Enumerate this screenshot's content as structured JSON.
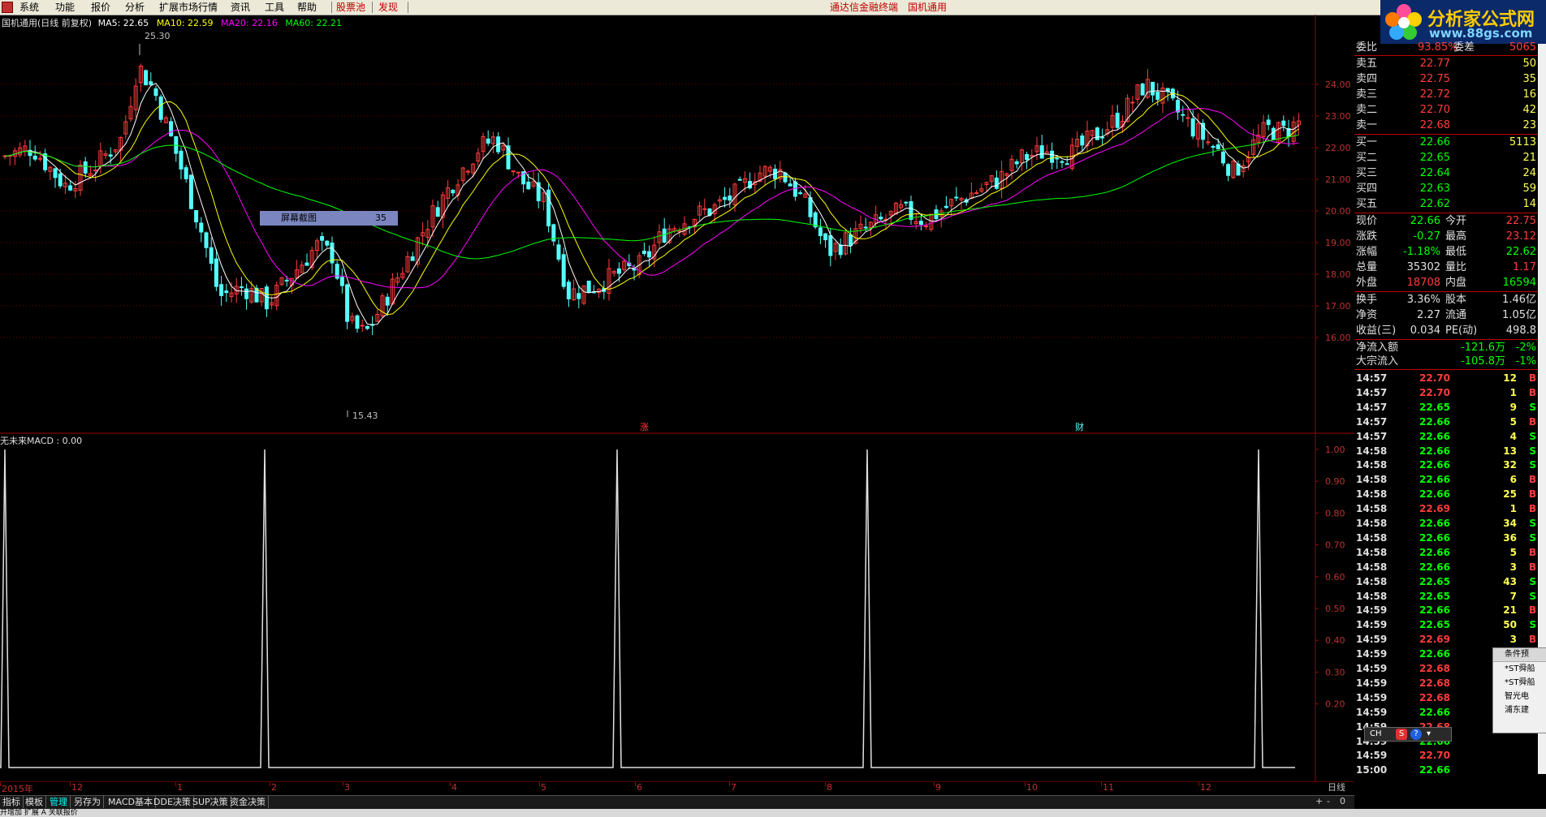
{
  "menubar": {
    "items": [
      "系统",
      "功能",
      "报价",
      "分析",
      "扩展市场行情",
      "资讯",
      "工具",
      "帮助",
      "股票池",
      "发现"
    ],
    "center_text": "通达信金融终端",
    "center_text2": "国机通用"
  },
  "logo": {
    "title": "分析家公式网",
    "url": "www.88gs.com"
  },
  "chart": {
    "name": "国机通用(日线 前复权)",
    "ma5_label": "MA5: 22.65",
    "ma10_label": "MA10: 22.59",
    "ma20_label": "MA20: 22.16",
    "ma60_label": "MA60: 22.21",
    "high_marker": "25.30",
    "low_marker": "15.43",
    "overlay_label": "屏幕截图",
    "overlay_value": "35",
    "event_marks": [
      "涨",
      "财"
    ],
    "price_ticks": [
      "24.00",
      "23.00",
      "22.00",
      "21.00",
      "20.00",
      "19.00",
      "18.00",
      "17.00",
      "16.00"
    ],
    "colors": {
      "ma5": "#ffffff",
      "ma10": "#ffff00",
      "ma20": "#ff00ff",
      "ma60": "#00ff00",
      "up": "#ff3c3c",
      "down": "#54ffff"
    }
  },
  "macd": {
    "title": "无未来MACD : 0.00",
    "ticks": [
      "1.00",
      "0.90",
      "0.80",
      "0.70",
      "0.60",
      "0.50",
      "0.40",
      "0.30",
      "0.20"
    ]
  },
  "dates": {
    "labels": [
      "2015年",
      "12",
      "1",
      "2",
      "3",
      "4",
      "5",
      "6",
      "7",
      "8",
      "9",
      "10",
      "11",
      "12"
    ],
    "timeframe": "日线"
  },
  "tabs": [
    "指标",
    "模板",
    "管理",
    "另存为",
    "MACD基本",
    "DDE决策",
    "SUP决策",
    "资金决策"
  ],
  "statusbar": {
    "text": "开增加 扩展 A 关联报价"
  },
  "quote": {
    "weibi_label": "委比",
    "weibi_value": "93.85%",
    "weibi_extra": "5065",
    "weibi_extra_label": "委差",
    "sell": [
      {
        "label": "卖五",
        "price": "22.77",
        "vol": "50"
      },
      {
        "label": "卖四",
        "price": "22.75",
        "vol": "35"
      },
      {
        "label": "卖三",
        "price": "22.72",
        "vol": "16"
      },
      {
        "label": "卖二",
        "price": "22.70",
        "vol": "42"
      },
      {
        "label": "卖一",
        "price": "22.68",
        "vol": "23"
      }
    ],
    "buy": [
      {
        "label": "买一",
        "price": "22.66",
        "vol": "5113"
      },
      {
        "label": "买二",
        "price": "22.65",
        "vol": "21"
      },
      {
        "label": "买三",
        "price": "22.64",
        "vol": "24"
      },
      {
        "label": "买四",
        "price": "22.63",
        "vol": "59"
      },
      {
        "label": "买五",
        "price": "22.62",
        "vol": "14"
      }
    ],
    "stats": [
      {
        "l1": "现价",
        "v1": "22.66",
        "l2": "今开",
        "v2": "22.75",
        "c1": "grn",
        "c2": "red"
      },
      {
        "l1": "涨跌",
        "v1": "-0.27",
        "l2": "最高",
        "v2": "23.12",
        "c1": "grn",
        "c2": "red"
      },
      {
        "l1": "涨幅",
        "v1": "-1.18%",
        "l2": "最低",
        "v2": "22.62",
        "c1": "grn",
        "c2": "grn"
      },
      {
        "l1": "总量",
        "v1": "35302",
        "l2": "量比",
        "v2": "1.17",
        "c1": "wht",
        "c2": "red"
      },
      {
        "l1": "外盘",
        "v1": "18708",
        "l2": "内盘",
        "v2": "16594",
        "c1": "red",
        "c2": "grn"
      }
    ],
    "stats2": [
      {
        "l1": "换手",
        "v1": "3.36%",
        "l2": "股本",
        "v2": "1.46亿"
      },
      {
        "l1": "净资",
        "v1": "2.27",
        "l2": "流通",
        "v2": "1.05亿"
      },
      {
        "l1": "收益(三)",
        "v1": "0.034",
        "l2": "PE(动)",
        "v2": "498.8"
      }
    ],
    "flow": [
      {
        "label": "净流入额",
        "value": "-121.6万",
        "pct": "-2%"
      },
      {
        "label": "大宗流入",
        "value": "-105.8万",
        "pct": "-1%"
      }
    ],
    "ticks": [
      {
        "t": "14:57",
        "p": "22.70",
        "v": "12",
        "s": "B"
      },
      {
        "t": "14:57",
        "p": "22.70",
        "v": "1",
        "s": "B"
      },
      {
        "t": "14:57",
        "p": "22.65",
        "v": "9",
        "s": "S"
      },
      {
        "t": "14:57",
        "p": "22.66",
        "v": "5",
        "s": "B"
      },
      {
        "t": "14:57",
        "p": "22.66",
        "v": "4",
        "s": "S"
      },
      {
        "t": "14:58",
        "p": "22.66",
        "v": "13",
        "s": "S"
      },
      {
        "t": "14:58",
        "p": "22.66",
        "v": "32",
        "s": "S"
      },
      {
        "t": "14:58",
        "p": "22.66",
        "v": "6",
        "s": "B"
      },
      {
        "t": "14:58",
        "p": "22.66",
        "v": "25",
        "s": "B"
      },
      {
        "t": "14:58",
        "p": "22.69",
        "v": "1",
        "s": "B"
      },
      {
        "t": "14:58",
        "p": "22.66",
        "v": "34",
        "s": "S"
      },
      {
        "t": "14:58",
        "p": "22.66",
        "v": "36",
        "s": "S"
      },
      {
        "t": "14:58",
        "p": "22.66",
        "v": "5",
        "s": "B"
      },
      {
        "t": "14:58",
        "p": "22.66",
        "v": "3",
        "s": "B"
      },
      {
        "t": "14:58",
        "p": "22.65",
        "v": "43",
        "s": "S"
      },
      {
        "t": "14:58",
        "p": "22.65",
        "v": "7",
        "s": "S"
      },
      {
        "t": "14:59",
        "p": "22.66",
        "v": "21",
        "s": "B"
      },
      {
        "t": "14:59",
        "p": "22.65",
        "v": "50",
        "s": "S"
      },
      {
        "t": "14:59",
        "p": "22.69",
        "v": "3",
        "s": "B"
      },
      {
        "t": "14:59",
        "p": "22.66",
        "v": "",
        "s": ""
      },
      {
        "t": "14:59",
        "p": "22.68",
        "v": "",
        "s": ""
      },
      {
        "t": "14:59",
        "p": "22.68",
        "v": "",
        "s": ""
      },
      {
        "t": "14:59",
        "p": "22.68",
        "v": "",
        "s": ""
      },
      {
        "t": "14:59",
        "p": "22.66",
        "v": "",
        "s": ""
      },
      {
        "t": "14:59",
        "p": "22.68",
        "v": "",
        "s": ""
      },
      {
        "t": "14:59",
        "p": "22.66",
        "v": "",
        "s": ""
      },
      {
        "t": "14:59",
        "p": "22.70",
        "v": "",
        "s": ""
      },
      {
        "t": "15:00",
        "p": "22.66",
        "v": "",
        "s": ""
      }
    ]
  },
  "popup": {
    "title": "条件预",
    "items": [
      "*ST舜船",
      "*ST舜船",
      "智光电",
      "浦东建"
    ]
  },
  "ime": {
    "text": "CH"
  }
}
